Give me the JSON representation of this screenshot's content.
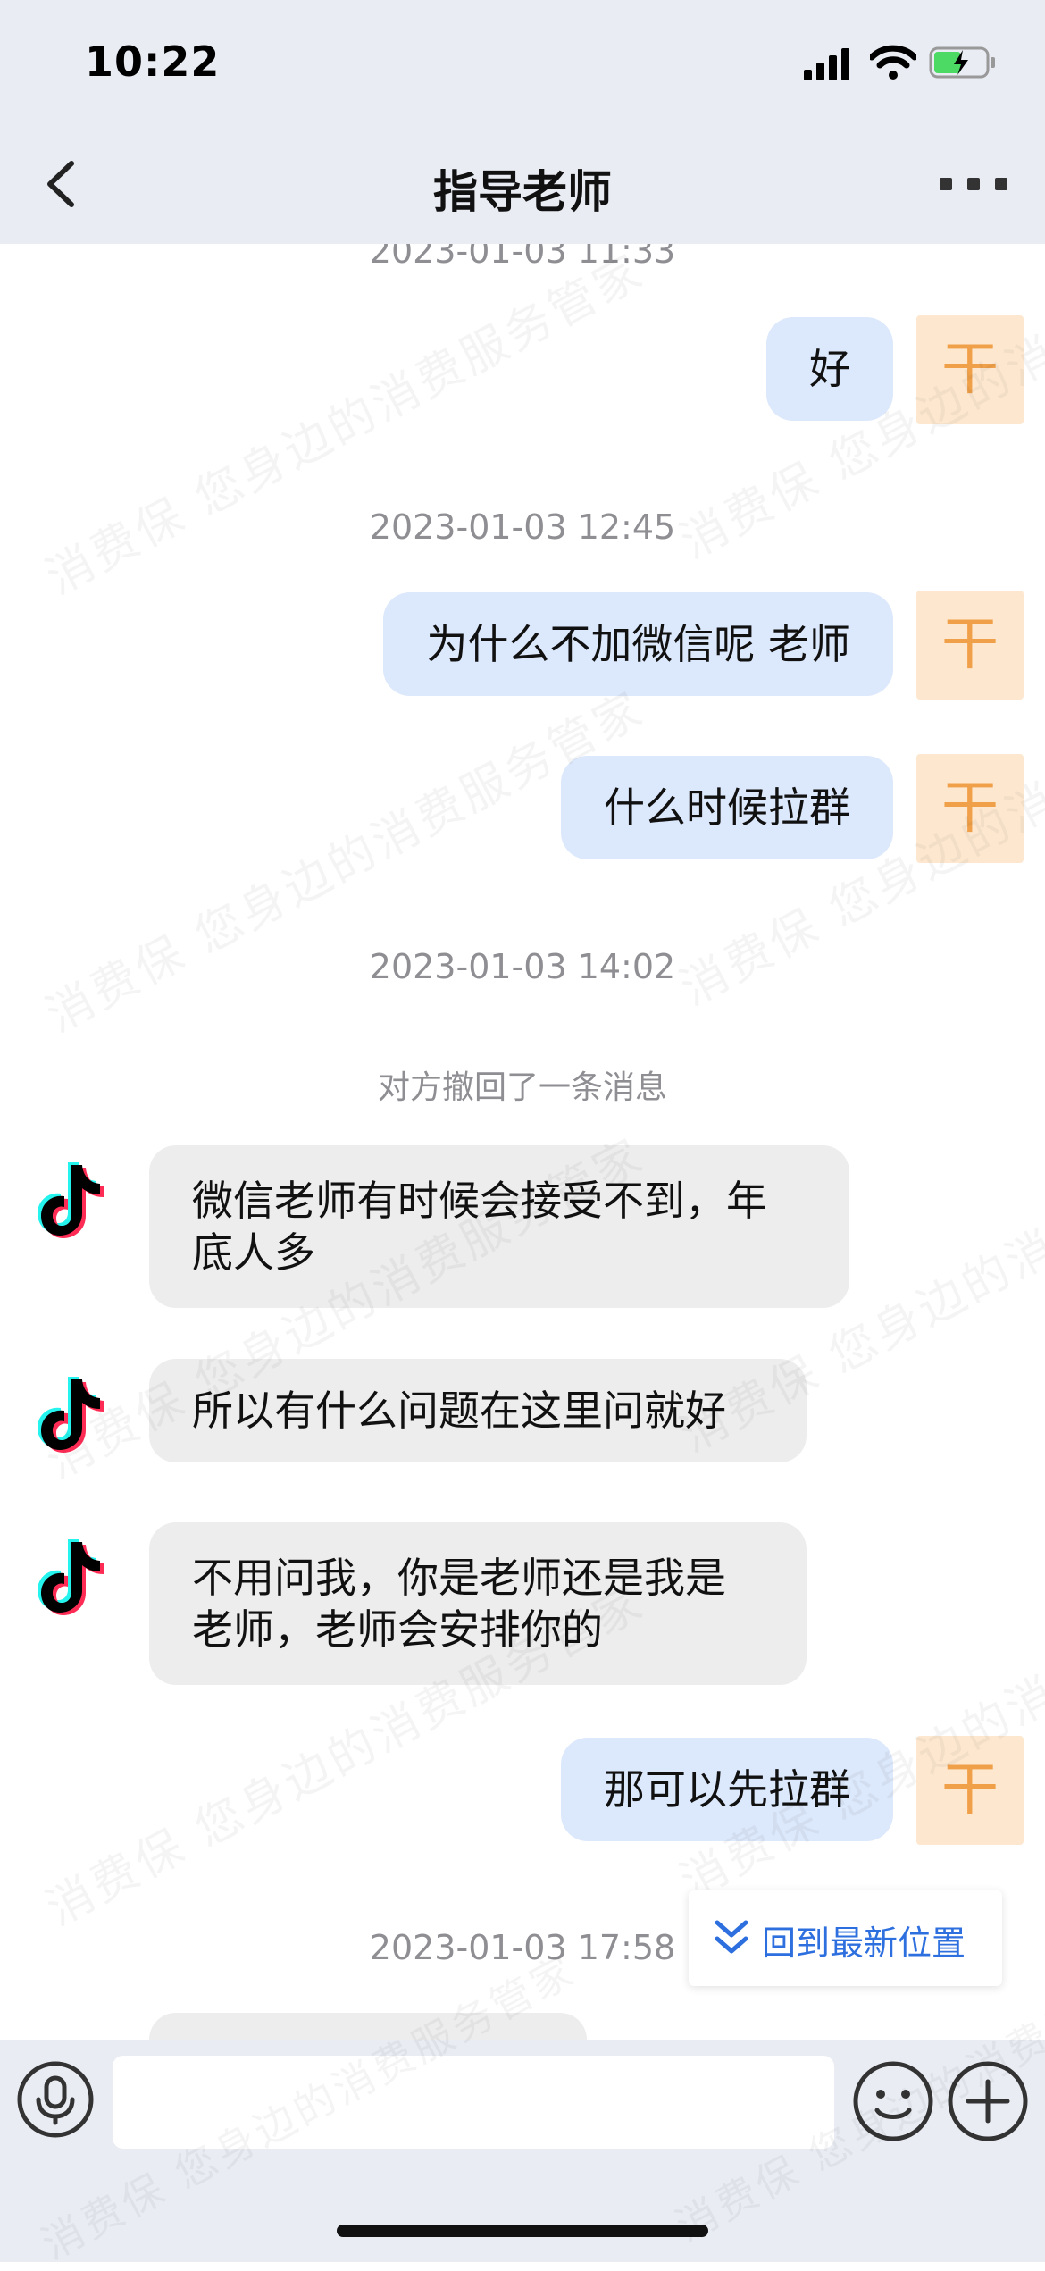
{
  "status_bar": {
    "time": "10:22"
  },
  "header": {
    "title": "指导老师"
  },
  "messages": [
    {
      "type": "timestamp",
      "text": "2023-01-03 11:33"
    },
    {
      "type": "sent",
      "text": "好",
      "avatar": "干"
    },
    {
      "type": "timestamp",
      "text": "2023-01-03 12:45"
    },
    {
      "type": "sent",
      "text": "为什么不加微信呢 老师",
      "avatar": "干"
    },
    {
      "type": "sent",
      "text": "什么时候拉群",
      "avatar": "干"
    },
    {
      "type": "timestamp",
      "text": "2023-01-03 14:02"
    },
    {
      "type": "system",
      "text": "对方撤回了一条消息"
    },
    {
      "type": "received",
      "line1": "微信老师有时候会接受不到，年",
      "line2": "底人多",
      "avatar_icon": "tiktok-icon"
    },
    {
      "type": "received",
      "text": "所以有什么问题在这里问就好",
      "avatar_icon": "tiktok-icon"
    },
    {
      "type": "received",
      "line1": "不用问我，你是老师还是我是",
      "line2": "老师，老师会安排你的",
      "avatar_icon": "tiktok-icon"
    },
    {
      "type": "sent",
      "text": "那可以先拉群",
      "avatar": "干"
    },
    {
      "type": "timestamp",
      "text": "2023-01-03 17:58"
    }
  ],
  "jump_to_latest": {
    "label": "回到最新位置"
  },
  "input_bar": {
    "placeholder": ""
  },
  "watermark": {
    "text": "消费保 您身边的消费服务管家"
  },
  "colors": {
    "sent_bubble": "#dce8fb",
    "received_bubble": "#ededed",
    "avatar_bg": "#fde7cf",
    "avatar_text": "#f0a048",
    "link_blue": "#2d6fde",
    "bar_bg": "#e9ecf3"
  }
}
